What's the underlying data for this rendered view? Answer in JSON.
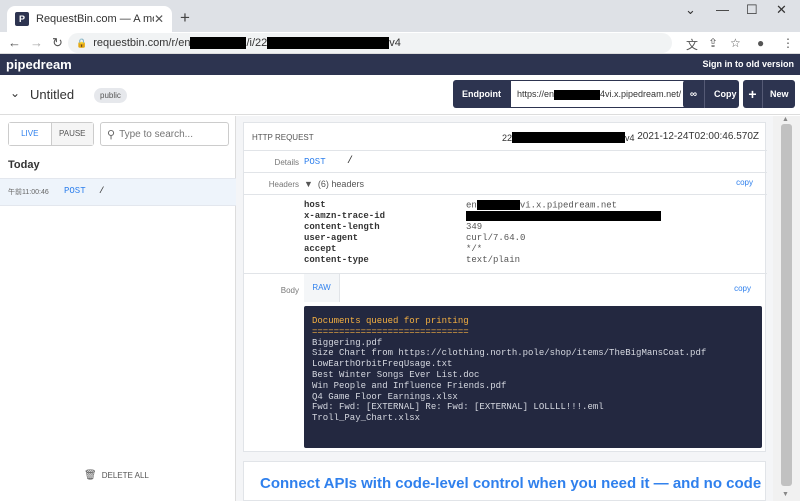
{
  "browser": {
    "tab_title": "RequestBin.com — A modern re",
    "url_prefix": "requestbin.com/r/en",
    "url_mid": "/i/22",
    "url_suffix": "v4"
  },
  "app": {
    "logo": "pipedream",
    "signin_link": "Sign in to old version"
  },
  "bin": {
    "title": "Untitled",
    "visibility": "public",
    "endpoint_label": "Endpoint",
    "endpoint_prefix": "https://en",
    "endpoint_suffix": "4vi.x.pipedream.net/",
    "copy_label": "Copy",
    "new_label": "New"
  },
  "sidebar": {
    "live_label": "LIVE",
    "pause_label": "PAUSE",
    "search_placeholder": "Type to search...",
    "group_label": "Today",
    "requests": [
      {
        "time": "午前11:00:46",
        "method": "POST",
        "path": "/"
      }
    ],
    "delete_all_label": "DELETE ALL"
  },
  "request": {
    "section_label": "HTTP REQUEST",
    "id_prefix": "22",
    "id_suffix": "v4",
    "timestamp": "2021-12-24T02:00:46.570Z",
    "details_label": "Details",
    "method": "POST",
    "path": "/",
    "headers_label": "Headers",
    "headers_toggle": "(6) headers",
    "copy_link": "copy",
    "headers": [
      {
        "key": "host",
        "value_prefix": "en",
        "value_suffix": "vi.x.pipedream.net"
      },
      {
        "key": "x-amzn-trace-id",
        "value_prefix": "",
        "value_suffix": ""
      },
      {
        "key": "content-length",
        "value_prefix": "349",
        "value_suffix": ""
      },
      {
        "key": "user-agent",
        "value_prefix": "curl/7.64.0",
        "value_suffix": ""
      },
      {
        "key": "accept",
        "value_prefix": "*/*",
        "value_suffix": ""
      },
      {
        "key": "content-type",
        "value_prefix": "text/plain",
        "value_suffix": ""
      }
    ],
    "body_label": "Body",
    "raw_tab": "RAW",
    "body_lines": [
      "Documents queued for printing",
      "=============================",
      "",
      "Biggering.pdf",
      "Size Chart from https://clothing.north.pole/shop/items/TheBigMansCoat.pdf",
      "LowEarthOrbitFreqUsage.txt",
      "Best Winter Songs Ever List.doc",
      "Win People and Influence Friends.pdf",
      "Q4 Game Floor Earnings.xlsx",
      "Fwd: Fwd: [EXTERNAL] Re: Fwd: [EXTERNAL] LOLLLL!!!.eml",
      "Troll_Pay_Chart.xlsx"
    ]
  },
  "banner": {
    "text": "Connect APIs with code-level control when you need it — and no code"
  }
}
